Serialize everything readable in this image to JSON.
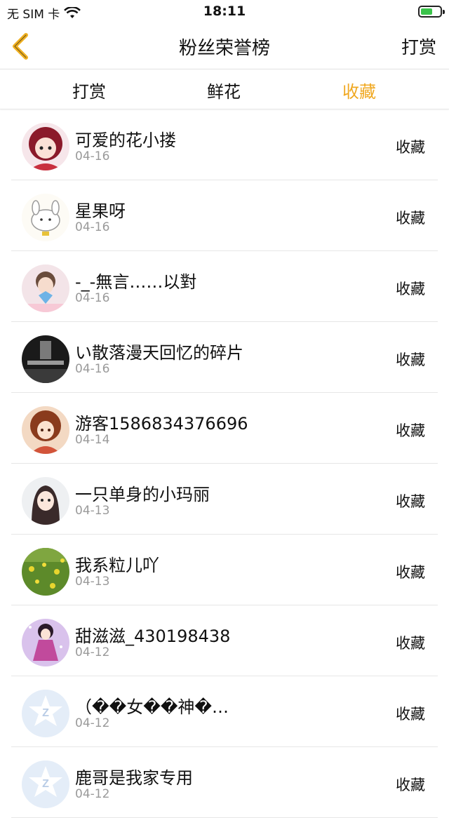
{
  "status_bar": {
    "carrier": "无 SIM 卡",
    "time": "18:11"
  },
  "nav": {
    "title": "粉丝荣誉榜",
    "right": "打赏"
  },
  "tabs": [
    {
      "label": "打赏",
      "active": false
    },
    {
      "label": "鲜花",
      "active": false
    },
    {
      "label": "收藏",
      "active": true
    }
  ],
  "colors": {
    "accent": "#f0a821",
    "divider": "#e6e6e6",
    "date": "#9a9a9a"
  },
  "list": [
    {
      "name": "可爱的花小搂",
      "date": "04-16",
      "action": "收藏",
      "avatar": "avatar-red-anime"
    },
    {
      "name": "星果呀",
      "date": "04-16",
      "action": "收藏",
      "avatar": "avatar-cartoon-bunny"
    },
    {
      "name": "-_-無言……以對",
      "date": "04-16",
      "action": "收藏",
      "avatar": "avatar-photo-blue"
    },
    {
      "name": "い散落漫天回忆的碎片",
      "date": "04-16",
      "action": "收藏",
      "avatar": "avatar-dark-photo"
    },
    {
      "name": "游客1586834376696",
      "date": "04-14",
      "action": "收藏",
      "avatar": "avatar-anime-brown"
    },
    {
      "name": "一只单身的小玛丽",
      "date": "04-13",
      "action": "收藏",
      "avatar": "avatar-anime-girl"
    },
    {
      "name": "我系粒儿吖",
      "date": "04-13",
      "action": "收藏",
      "avatar": "avatar-flower-field"
    },
    {
      "name": "甜滋滋_430198438",
      "date": "04-12",
      "action": "收藏",
      "avatar": "avatar-anime-purple"
    },
    {
      "name": "（��女��神�…",
      "date": "04-12",
      "action": "收藏",
      "avatar": "avatar-default"
    },
    {
      "name": "鹿哥是我家专用",
      "date": "04-12",
      "action": "收藏",
      "avatar": "avatar-default"
    }
  ]
}
